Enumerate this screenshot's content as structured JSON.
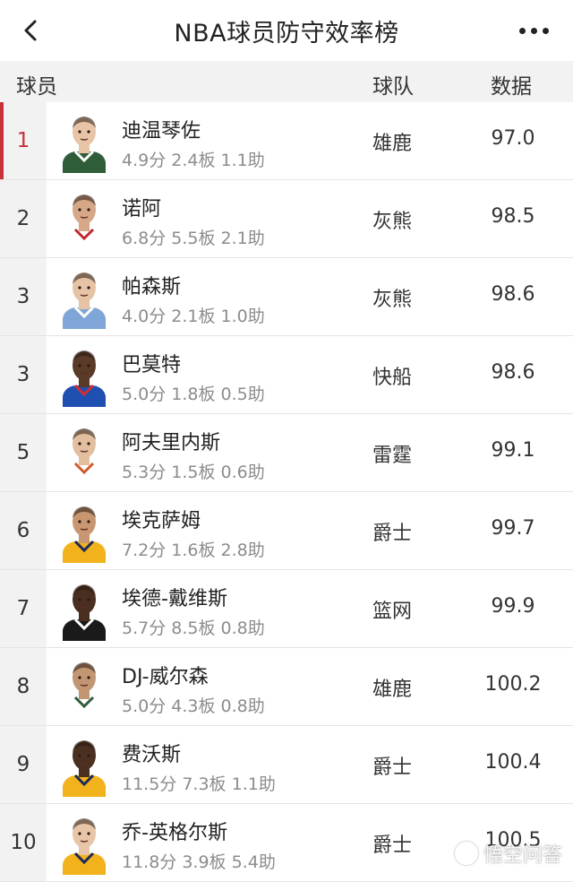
{
  "header": {
    "title": "NBA球员防守效率榜"
  },
  "columns": {
    "player": "球员",
    "team": "球队",
    "data": "数据"
  },
  "players": [
    {
      "rank": "1",
      "name": "迪温琴佐",
      "stats": "4.9分 2.4板 1.1助",
      "team": "雄鹿",
      "value": "97.0",
      "skin": "#e9c4a6",
      "jersey": "#2f5d3a",
      "trim": "#ffffff"
    },
    {
      "rank": "2",
      "name": "诺阿",
      "stats": "6.8分 5.5板 2.1助",
      "team": "灰熊",
      "value": "98.5",
      "skin": "#d6a888",
      "jersey": "#ffffff",
      "trim": "#c0282e"
    },
    {
      "rank": "3",
      "name": "帕森斯",
      "stats": "4.0分 2.1板 1.0助",
      "team": "灰熊",
      "value": "98.6",
      "skin": "#e7c3a5",
      "jersey": "#7fa6d6",
      "trim": "#ffffff"
    },
    {
      "rank": "3",
      "name": "巴莫特",
      "stats": "5.0分 1.8板 0.5助",
      "team": "快船",
      "value": "98.6",
      "skin": "#5a3a28",
      "jersey": "#1f4fb0",
      "trim": "#d32f2f"
    },
    {
      "rank": "5",
      "name": "阿夫里内斯",
      "stats": "5.3分 1.5板 0.6助",
      "team": "雷霆",
      "value": "99.1",
      "skin": "#e3bfa0",
      "jersey": "#ffffff",
      "trim": "#d05a2a"
    },
    {
      "rank": "6",
      "name": "埃克萨姆",
      "stats": "7.2分 1.6板 2.8助",
      "team": "爵士",
      "value": "99.7",
      "skin": "#c89772",
      "jersey": "#f2b21b",
      "trim": "#1b2a5a"
    },
    {
      "rank": "7",
      "name": "埃德-戴维斯",
      "stats": "5.7分 8.5板 0.8助",
      "team": "篮网",
      "value": "99.9",
      "skin": "#4a2e20",
      "jersey": "#1a1a1a",
      "trim": "#ffffff"
    },
    {
      "rank": "8",
      "name": "DJ-威尔森",
      "stats": "5.0分 4.3板 0.8助",
      "team": "雄鹿",
      "value": "100.2",
      "skin": "#c39673",
      "jersey": "#ffffff",
      "trim": "#2f5d3a"
    },
    {
      "rank": "9",
      "name": "费沃斯",
      "stats": "11.5分 7.3板 1.1助",
      "team": "爵士",
      "value": "100.4",
      "skin": "#4b3022",
      "jersey": "#f2b21b",
      "trim": "#1b2a5a"
    },
    {
      "rank": "10",
      "name": "乔-英格尔斯",
      "stats": "11.8分 3.9板 5.4助",
      "team": "爵士",
      "value": "100.5",
      "skin": "#e8c5a7",
      "jersey": "#f2b21b",
      "trim": "#1b2a5a"
    }
  ],
  "watermark": {
    "text": "悟空问答"
  }
}
